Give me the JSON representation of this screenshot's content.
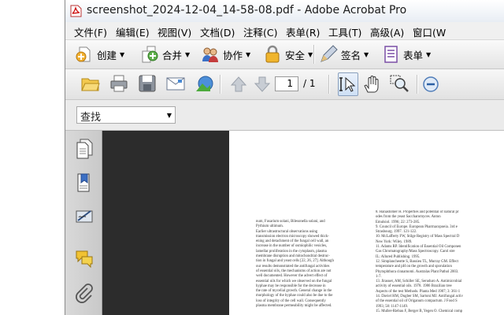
{
  "window": {
    "title": "screenshot_2024-12-04_14-58-08.pdf - Adobe Acrobat Pro"
  },
  "menu": [
    "文件(F)",
    "编辑(E)",
    "视图(V)",
    "文档(D)",
    "注释(C)",
    "表单(R)",
    "工具(T)",
    "高级(A)",
    "窗口(W"
  ],
  "toolbar": {
    "create": "创建",
    "combine": "合并",
    "collaborate": "协作",
    "secure": "安全",
    "sign": "签名",
    "forms": "表单"
  },
  "navigation": {
    "current_page": "1",
    "total_pages": "/ 1"
  },
  "find": {
    "value": "查找"
  },
  "document": {
    "left_column": [
      "num, Fusarium solani, Bilesonella solani, and",
      "Pythium ultimum.",
      "Earlier ultrastructural observations using",
      "transmission electron microscopy showed thick-",
      "ening and detachment of the fungal cell wall, an",
      "increase in the number of osmiophilic vesicles,",
      "lamellar proliferation in the cytoplasm, plasma",
      "membrane disruption and mitochondrial destruc-",
      "tion in fungal and yeast cells [22, 26, 27]. Although",
      "our results demonstrated the antifungal activities",
      "of essential oils, the mechanisms of action are not",
      "well documented. However the advert effect of",
      "essential oils for which we observed on the fungal",
      "hyphae may be responsible for the decrease in",
      "the rate of mycelial growth. General change in the",
      "morphology of the hyphae could also be due to the",
      "loss of integrity of the cell wall. Consequently",
      "plasma membrane permeability might be affected."
    ],
    "right_column": [
      "8.  Hanastomer H. Properties and potential of natural pr",
      "     odes from the yeast Saccharomyces. Anton",
      "     Emulsiol. 1996; 22: 273-285.",
      "9.  Council of Europe. European Pharmacopoeia. 3rd e",
      "     Strasbourg. 1997. 121-122.",
      "10. McLafferty FW, Stilge Registry of Mass Spectral D",
      "     New York: Wiley. 1989.",
      "11. Adams RP. Identification of Essential Oil Componen",
      "     Gas Chromatography/Mass Spectroscopy. Carol stre",
      "     IL: Allured Publishing. 1995.",
      "12. Simplancheotte S, Bassieu TL, Murray GM. Effect",
      "     temperature and pH on the growth and sporulation",
      "     Phytophthora cinnamomi. Australas Plant Pathol 2003.",
      "     1-7.",
      "13. Jirasuet, AM, Schiller SE, Seruduro A. Antimicrobial",
      "     activity of essential oils. 1978. 1986 Brazilian tree",
      "     Aspects of the test Methods. Planta Med 1987; 3: 361-1",
      "14. Daviel HM, Dugber SM, Sartoni MJ. Antifungal activ",
      "     of the essential oil of Origanum compactum. J Food S",
      "     1993; 58: 1147-1149.",
      "15. Muller-Riebau F, Berger B, Yegen O. Chemical comp"
    ]
  },
  "colors": {
    "doc_background": "#2c2c2c",
    "page": "#ffffff",
    "chrome": "#f0f0f0"
  },
  "icons": [
    "pdf-app-icon",
    "create-icon",
    "combine-icon",
    "collaborate-icon",
    "lock-icon",
    "pen-icon",
    "forms-icon",
    "open-folder-icon",
    "print-icon",
    "save-icon",
    "email-icon",
    "upload-icon",
    "up-arrow-icon",
    "down-arrow-icon",
    "select-tool-icon",
    "hand-tool-icon",
    "zoom-tool-icon",
    "zoom-out-icon",
    "pages-icon",
    "bookmarks-icon",
    "signatures-icon",
    "comments-icon",
    "attachments-icon"
  ]
}
